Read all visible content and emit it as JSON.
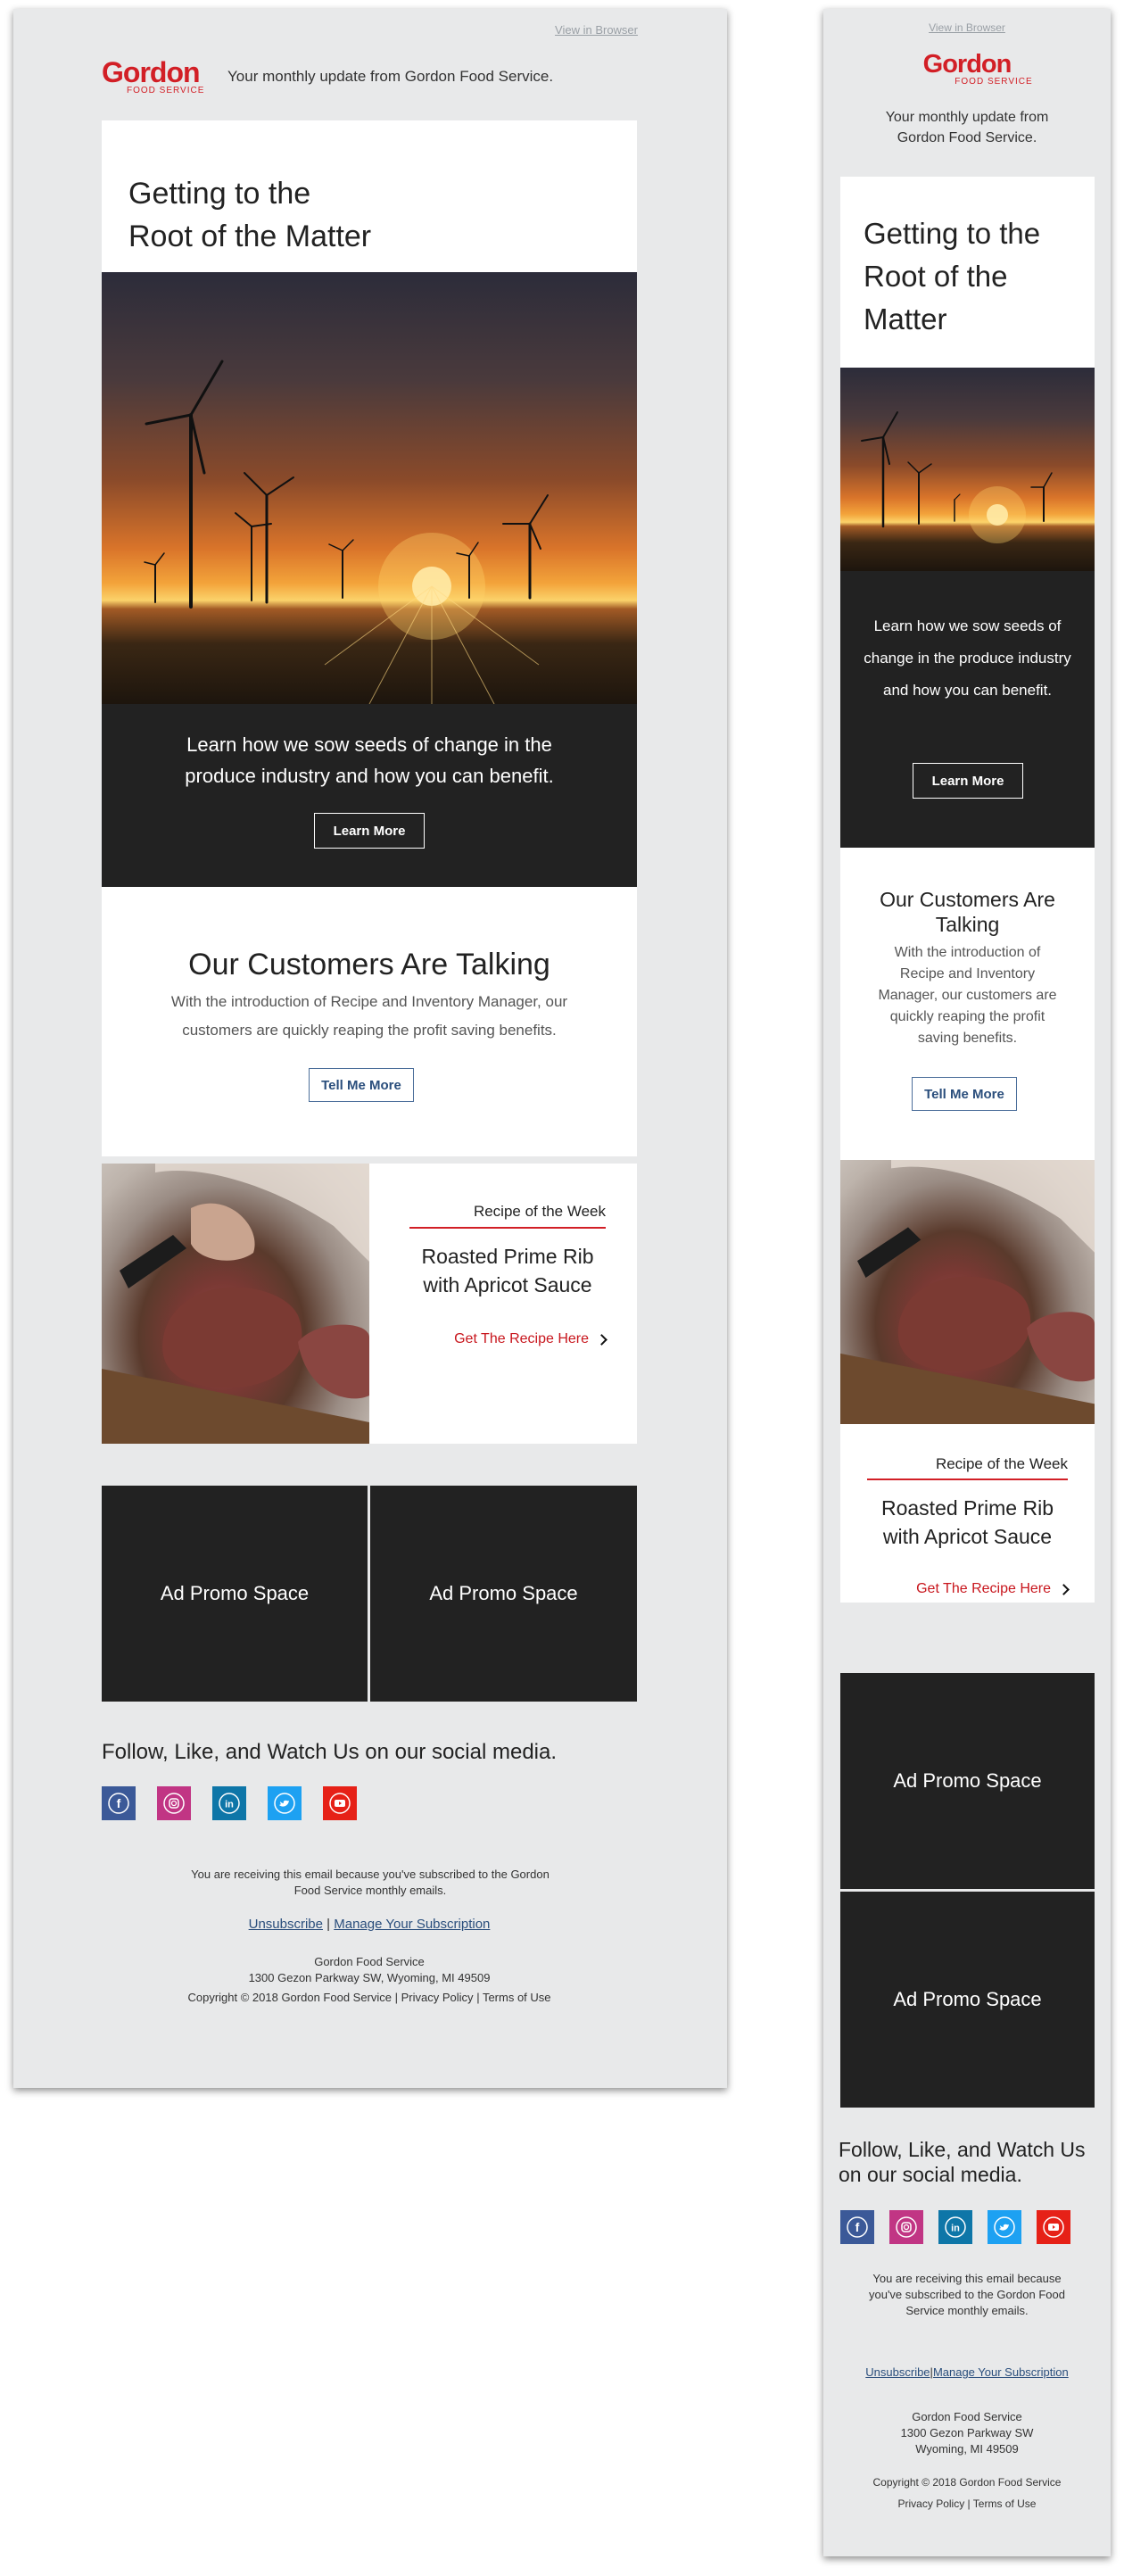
{
  "header": {
    "view_in_browser": "View in Browser",
    "brand_name": "Gordon",
    "brand_sub": "FOOD SERVICE",
    "tagline": "Your monthly update from Gordon Food Service."
  },
  "hero": {
    "title_line1": "Getting to the",
    "title_line2": "Root of the Matter",
    "mobile_title": [
      "Getting to the",
      "Root of the",
      "Matter"
    ],
    "body": "Learn how we sow seeds of change in the produce industry and how you can benefit.",
    "button": "Learn More"
  },
  "customers": {
    "title": "Our Customers Are Talking",
    "body": "With the introduction of Recipe and Inventory Manager, our customers are quickly reaping the profit saving benefits.",
    "button": "Tell Me More"
  },
  "recipe": {
    "kicker": "Recipe of the Week",
    "title_line1": "Roasted Prime Rib",
    "title_line2": "with Apricot Sauce",
    "link": "Get The Recipe Here"
  },
  "promos": [
    "Ad Promo Space",
    "Ad Promo Space"
  ],
  "social": {
    "heading": "Follow, Like, and Watch Us on our social media.",
    "icons": [
      "facebook-icon",
      "instagram-icon",
      "linkedin-icon",
      "twitter-icon",
      "youtube-icon"
    ]
  },
  "footer": {
    "notice": "You are receiving this email because you've subscribed to the Gordon Food Service monthly emails.",
    "unsubscribe": "Unsubscribe",
    "separator": "|",
    "manage": "Manage Your Subscription",
    "company": "Gordon Food Service",
    "address_line1": "1300 Gezon Parkway SW, Wyoming, MI 49509",
    "address_street": "1300 Gezon Parkway SW",
    "address_city": "Wyoming, MI 49509",
    "copyright": "Copyright © 2018 Gordon Food Service",
    "privacy": "Privacy Policy",
    "terms": "Terms of Use"
  },
  "colors": {
    "brand_red": "#d21f26",
    "dark_panel": "#222222",
    "link_blue": "#2a4e7c",
    "background": "#e8e9ea"
  }
}
